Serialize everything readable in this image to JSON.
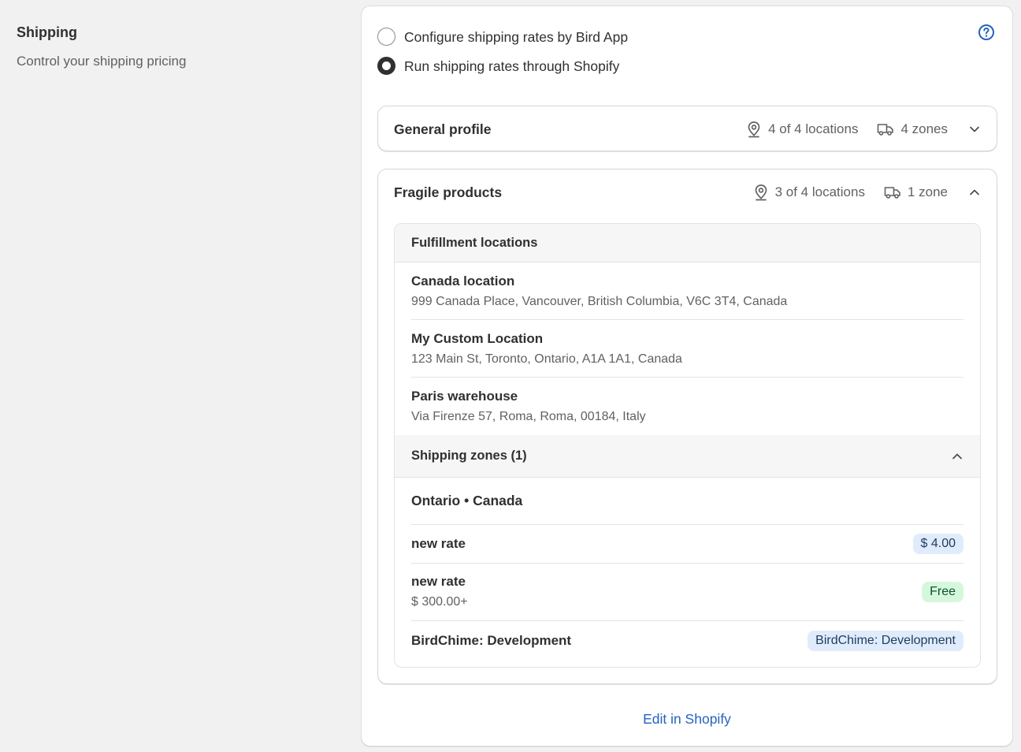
{
  "section": {
    "title": "Shipping",
    "description": "Control your shipping pricing"
  },
  "options": [
    {
      "label": "Configure shipping rates by Bird App",
      "checked": false
    },
    {
      "label": "Run shipping rates through Shopify",
      "checked": true
    }
  ],
  "profiles": {
    "general": {
      "name": "General profile",
      "locations": "4 of 4 locations",
      "zones": "4 zones"
    },
    "fragile": {
      "name": "Fragile products",
      "locations": "3 of 4 locations",
      "zones": "1 zone",
      "fulfillment_header": "Fulfillment locations",
      "locations_list": [
        {
          "name": "Canada location",
          "address": "999 Canada Place, Vancouver, British Columbia, V6C 3T4, Canada"
        },
        {
          "name": "My Custom Location",
          "address": "123 Main St, Toronto, Ontario, A1A 1A1, Canada"
        },
        {
          "name": "Paris warehouse",
          "address": "Via Firenze 57, Roma, Roma, 00184, Italy"
        }
      ],
      "zones_header": "Shipping zones (1)",
      "zone_name": "Ontario • Canada",
      "rates": [
        {
          "name": "new rate",
          "condition": "",
          "price": "$ 4.00"
        },
        {
          "name": "new rate",
          "condition": "$ 300.00+",
          "price": "Free"
        },
        {
          "name": "BirdChime: Development",
          "condition": "",
          "price": "BirdChime: Development"
        }
      ]
    }
  },
  "edit_link": "Edit in Shopify",
  "colors": {
    "link": "#2463bc",
    "badge_blue": "#e0ecfb",
    "badge_green": "#d5f8dc"
  }
}
